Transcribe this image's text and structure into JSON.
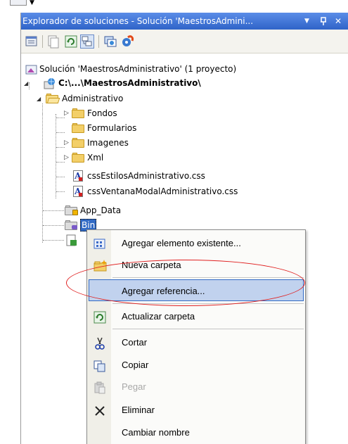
{
  "window": {
    "title": "Explorador de soluciones - Solución 'MaestrosAdmini...",
    "dropdown_glyph": "▼",
    "pin_glyph": "ꟼ",
    "close_glyph": "✕"
  },
  "toolbar": {
    "buttons": [
      "properties-icon",
      "show-all-files-icon",
      "refresh-icon",
      "nest-related-files-icon",
      "copy-website-icon",
      "asp-net-config-icon"
    ]
  },
  "tree": {
    "solution": "Solución 'MaestrosAdministrativo' (1 proyecto)",
    "project": "C:\\...\\MaestrosAdministrativo\\",
    "folder_admin": "Administrativo",
    "subfolders": [
      "Fondos",
      "Formularios",
      "Imagenes",
      "Xml"
    ],
    "css_files": [
      "cssEstilosAdministrativo.css",
      "cssVentanaModalAdministrativo.css"
    ],
    "app_data": "App_Data",
    "bin": "Bin"
  },
  "context_menu": {
    "items": [
      {
        "label": "Agregar elemento existente...",
        "icon": "add-existing-item-icon"
      },
      {
        "label": "Nueva carpeta",
        "icon": "new-folder-icon"
      },
      {
        "label": "Agregar referencia...",
        "icon": ""
      },
      {
        "label": "Actualizar carpeta",
        "icon": "refresh-icon"
      },
      {
        "label": "Cortar",
        "icon": "scissors-icon"
      },
      {
        "label": "Copiar",
        "icon": "copy-icon"
      },
      {
        "label": "Pegar",
        "icon": "paste-icon"
      },
      {
        "label": "Eliminar",
        "icon": "delete-x-icon"
      },
      {
        "label": "Cambiar nombre",
        "icon": ""
      }
    ]
  },
  "colors": {
    "title_bar": "#2f63c8",
    "selection": "#316ac5",
    "menu_highlight": "#c1d2ee",
    "annotation_ellipse": "#e02020"
  }
}
